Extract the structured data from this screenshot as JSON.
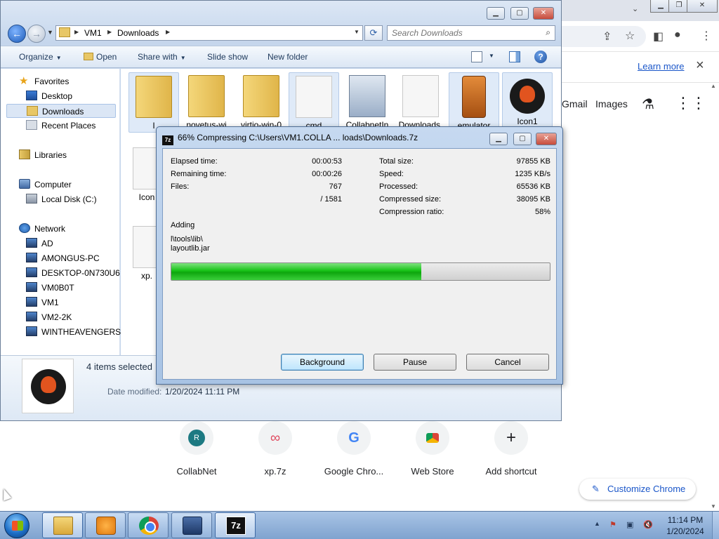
{
  "chrome": {
    "learn_more": "Learn more",
    "links": [
      "Gmail",
      "Images"
    ],
    "shortcuts": [
      {
        "label": "CollabNet",
        "letter": "R"
      },
      {
        "label": "xp.7z"
      },
      {
        "label": "Google Chro..."
      },
      {
        "label": "Web Store"
      },
      {
        "label": "Add shortcut"
      }
    ],
    "customize_label": "Customize Chrome"
  },
  "explorer": {
    "breadcrumb": [
      "VM1",
      "Downloads"
    ],
    "search_placeholder": "Search Downloads",
    "toolbar": {
      "organize": "Organize",
      "open": "Open",
      "share_with": "Share with",
      "slide_show": "Slide show",
      "new_folder": "New folder"
    },
    "nav": {
      "favorites": "Favorites",
      "desktop": "Desktop",
      "downloads": "Downloads",
      "recent_places": "Recent Places",
      "libraries": "Libraries",
      "computer": "Computer",
      "local_disk": "Local Disk (C:)",
      "network": "Network",
      "network_items": [
        "AD",
        "AMONGUS-PC",
        "DESKTOP-0N730U6",
        "VM0B0T",
        "VM1",
        "VM2-2K",
        "WINTHEAVENGERS"
      ]
    },
    "files": [
      {
        "label": "I",
        "selected": true
      },
      {
        "label": "novetus-wi",
        "selected": false
      },
      {
        "label": "virtio-win-0",
        "selected": false
      },
      {
        "label": "cmd",
        "selected": true
      },
      {
        "label": "CollabnetIn",
        "selected": false
      },
      {
        "label": "Downloads.",
        "selected": false
      },
      {
        "label": "emulator",
        "selected": true
      },
      {
        "label": "Icon1",
        "selected": true
      }
    ],
    "partial_files": [
      "Icon",
      "xp."
    ],
    "details": {
      "count": "4 items selected",
      "date_label": "Date modified:",
      "date_value": "1/20/2024 11:11 PM"
    }
  },
  "dialog": {
    "title": "66% Compressing C:\\Users\\VM1.COLLA ... loads\\Downloads.7z",
    "left_stats": [
      {
        "label": "Elapsed time:",
        "value": "00:00:53"
      },
      {
        "label": "Remaining time:",
        "value": "00:00:26"
      },
      {
        "label": "Files:",
        "value": "767"
      },
      {
        "label": "",
        "value": "/ 1581"
      }
    ],
    "right_stats": [
      {
        "label": "Total size:",
        "value": "97855 KB"
      },
      {
        "label": "Speed:",
        "value": "1235 KB/s"
      },
      {
        "label": "Processed:",
        "value": "65536 KB"
      },
      {
        "label": "Compressed size:",
        "value": "38095 KB"
      },
      {
        "label": "Compression ratio:",
        "value": "58%"
      }
    ],
    "action": "Adding",
    "current_path": "l\\tools\\lib\\",
    "current_file": "layoutlib.jar",
    "progress": 0.66,
    "buttons": {
      "background": "Background",
      "pause": "Pause",
      "cancel": "Cancel"
    }
  },
  "taskbar": {
    "clock_time": "11:14 PM",
    "clock_date": "1/20/2024"
  }
}
